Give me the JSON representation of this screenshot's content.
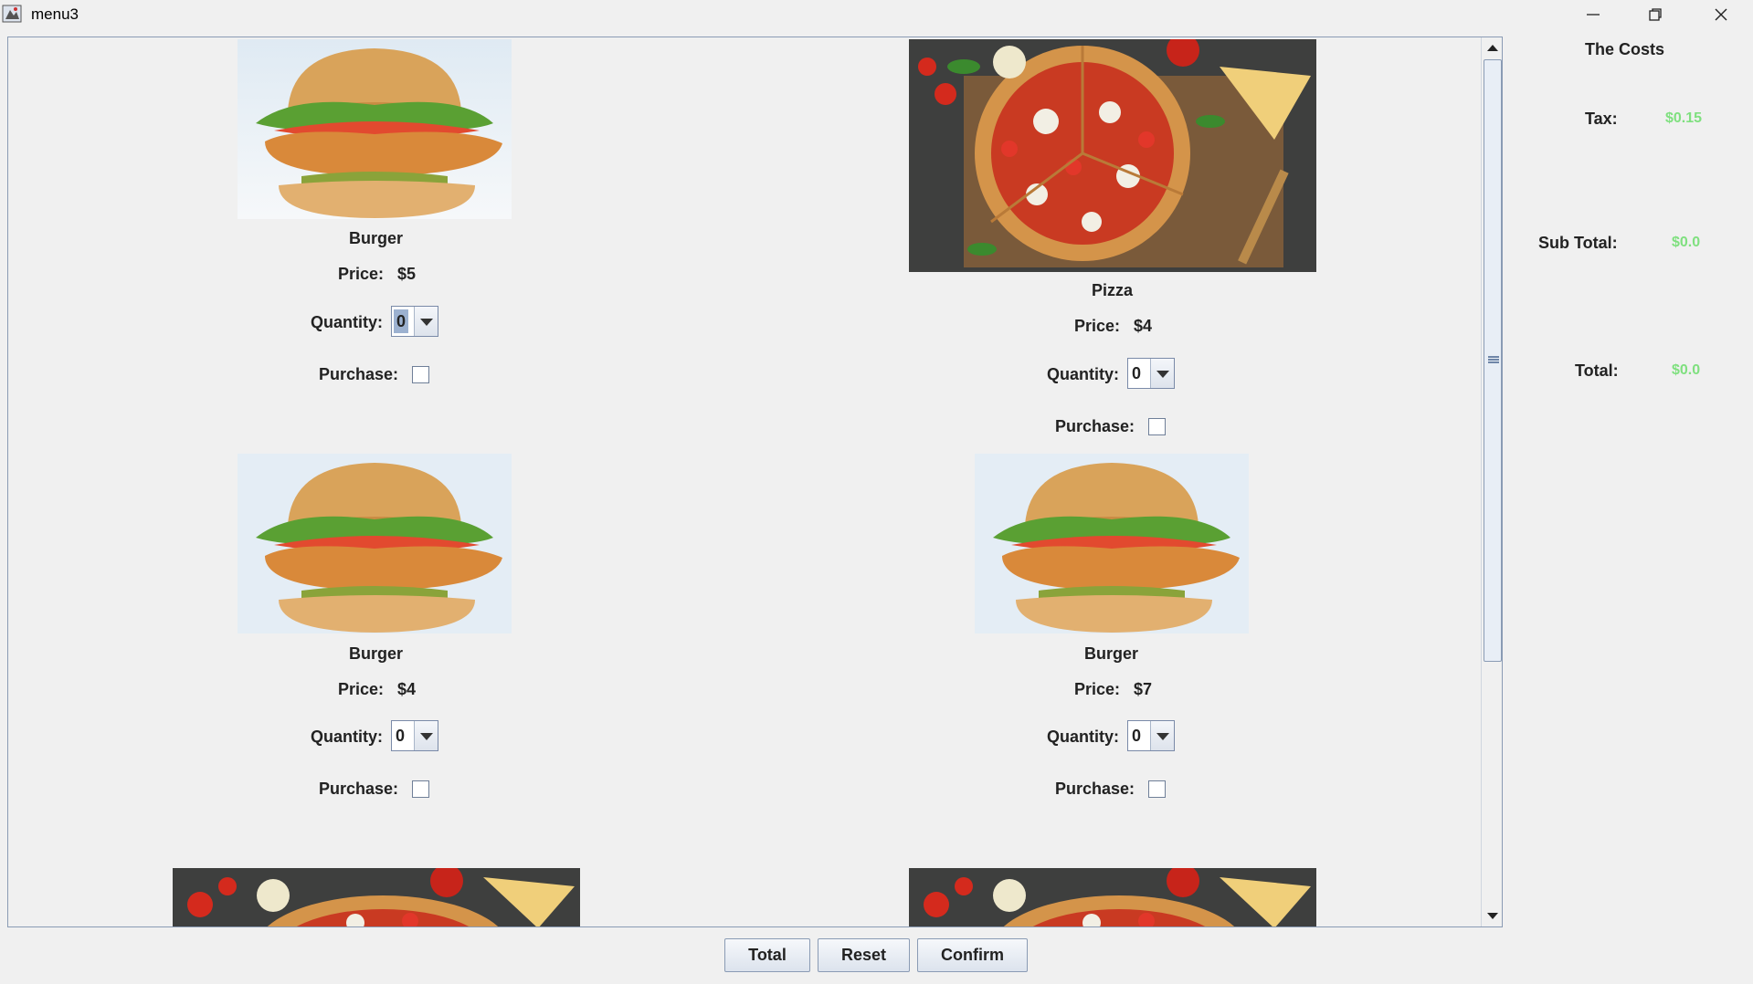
{
  "window": {
    "title": "menu3"
  },
  "menu": {
    "items": [
      {
        "name": "Burger",
        "price_label": "Price:",
        "price": "$5",
        "quantity_label": "Quantity:",
        "quantity": "0",
        "purchase_label": "Purchase:",
        "image": "burger",
        "purchased": false
      },
      {
        "name": "Pizza",
        "price_label": "Price:",
        "price": "$4",
        "quantity_label": "Quantity:",
        "quantity": "0",
        "purchase_label": "Purchase:",
        "image": "pizza",
        "purchased": false
      },
      {
        "name": "Burger",
        "price_label": "Price:",
        "price": "$4",
        "quantity_label": "Quantity:",
        "quantity": "0",
        "purchase_label": "Purchase:",
        "image": "burger",
        "purchased": false
      },
      {
        "name": "Burger",
        "price_label": "Price:",
        "price": "$7",
        "quantity_label": "Quantity:",
        "quantity": "0",
        "purchase_label": "Purchase:",
        "image": "burger",
        "purchased": false
      }
    ],
    "partial_images": [
      "pizza",
      "pizza"
    ]
  },
  "costs": {
    "title": "The  Costs",
    "tax_label": "Tax:",
    "tax_value": "$0.15",
    "subtotal_label": "Sub Total:",
    "subtotal_value": "$0.0",
    "total_label": "Total:",
    "total_value": "$0.0",
    "value_color": "#7fe07f"
  },
  "buttons": {
    "total": "Total",
    "reset": "Reset",
    "confirm": "Confirm"
  }
}
